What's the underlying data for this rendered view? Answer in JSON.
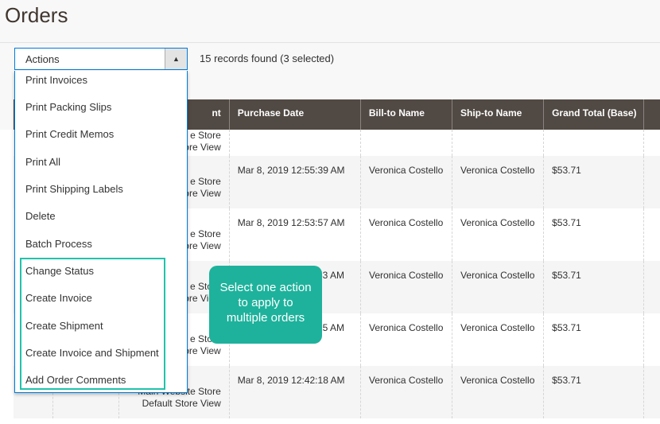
{
  "page": {
    "title": "Orders"
  },
  "toolbar": {
    "actions_label": "Actions",
    "records_found": "15 records found (3 selected)"
  },
  "grid": {
    "columns": [
      "",
      "",
      "nt",
      "Purchase Date",
      "Bill-to Name",
      "Ship-to Name",
      "Grand Total (Base)",
      ""
    ],
    "rows": [
      {
        "store_line1": "e Store",
        "store_line2": "ore View",
        "date": "",
        "bill_to": "",
        "ship_to": "",
        "total": ""
      },
      {
        "store_line1": "e Store",
        "store_line2": "ore View",
        "date": "Mar 8, 2019 12:55:39 AM",
        "bill_to": "Veronica Costello",
        "ship_to": "Veronica Costello",
        "total": "$53.71"
      },
      {
        "store_line1": "e Store",
        "store_line2": "ore View",
        "date": "Mar 8, 2019 12:53:57 AM",
        "bill_to": "Veronica Costello",
        "ship_to": "Veronica Costello",
        "total": "$53.71"
      },
      {
        "store_line1": "e Store",
        "store_line2": "ore View",
        "date": "53 AM",
        "bill_to": "Veronica Costello",
        "ship_to": "Veronica Costello",
        "total": "$53.71"
      },
      {
        "store_line1": "e Store",
        "store_line2": "ore View",
        "date": "15 AM",
        "bill_to": "Veronica Costello",
        "ship_to": "Veronica Costello",
        "total": "$53.71"
      },
      {
        "store_line1": "Main Website Store",
        "store_line2": "Default Store View",
        "date": "Mar 8, 2019 12:42:18 AM",
        "bill_to": "Veronica Costello",
        "ship_to": "Veronica Costello",
        "total": "$53.71"
      }
    ]
  },
  "dropdown": {
    "items": [
      "Print Invoices",
      "Print Packing Slips",
      "Print Credit Memos",
      "Print All",
      "Print Shipping Labels",
      "Delete",
      "Batch Process",
      "Change Status",
      "Create Invoice",
      "Create Shipment",
      "Create Invoice and Shipment",
      "Add Order Comments"
    ]
  },
  "callout": {
    "line1": "Select one action",
    "line2": "to apply to",
    "line3": "multiple orders"
  },
  "colors": {
    "header_bg": "#514943",
    "accent_blue": "#007bdb",
    "highlight_teal": "#21c3ab",
    "callout_bg": "#1eb29c"
  },
  "icons": {
    "dropdown_toggle": "caret-up-icon"
  }
}
